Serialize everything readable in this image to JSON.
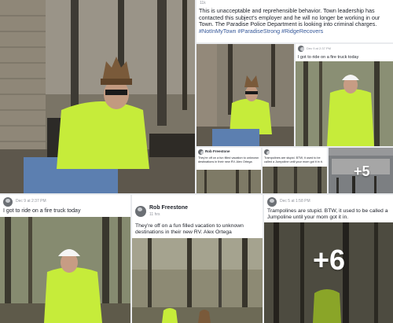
{
  "collage": {
    "more_count_a": "+5",
    "more_count_b": "+6"
  },
  "post_main": {
    "likes": "11k",
    "text": "This is unacceptable and reprehensible behavior. Town leadership has contacted this subject's employer and he will no longer be working in our Town. The Paradise Police Department is looking into criminal charges.",
    "hashtags": "#NotInMyTown #ParadiseStrong #RidgeRecovers"
  },
  "post_fire_truck_small": {
    "time": "Dec 9 at 2:37 PM",
    "text": "I got to ride on a fire truck today"
  },
  "post_rv_small": {
    "author": "Rob Freestone",
    "text": "They're off on a fun filled vacation to unknown destinations in their new RV. Alex Ortega"
  },
  "post_trampoline_small": {
    "text": "Trampolines are stupid. BTW, it used to be called a Jumpoline until your mom got it in it."
  },
  "post_fire_truck": {
    "time": "Dec 9 at 2:37 PM",
    "text": "I got to ride on a fire truck today"
  },
  "post_rv": {
    "author": "Rob Freestone",
    "time": "11 hrs",
    "text": "They're off on a fun filled vacation to unknown destinations in their new RV. Alex Ortega"
  },
  "post_trampoline": {
    "time": "Dec 5 at 1:58 PM",
    "text": "Trampolines are stupid. BTW, it used to be called a Jumpoline until your mom got it in."
  },
  "colors": {
    "hashtag": "#365899",
    "vest": "#c6ec3a",
    "page_bg": "#e9ebee"
  }
}
